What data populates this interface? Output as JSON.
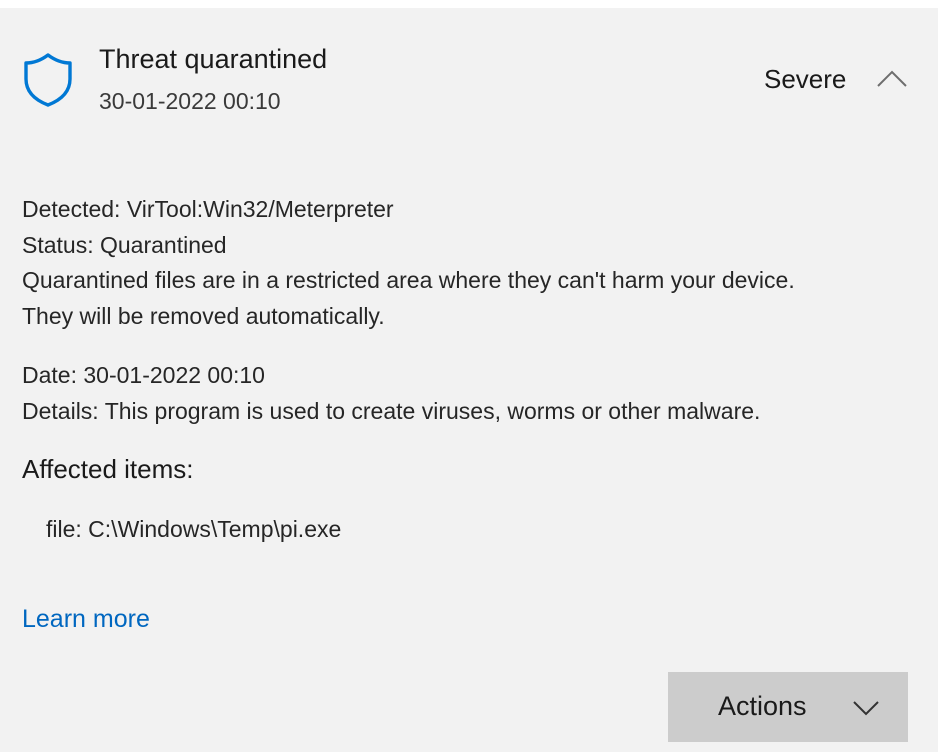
{
  "threat": {
    "title": "Threat quarantined",
    "timestamp": "30-01-2022 00:10",
    "severity": "Severe",
    "shield_icon": "shield-icon",
    "expand_icon": "chevron-up-icon",
    "accent_color": "#0078d4"
  },
  "details": {
    "detected_label": "Detected:",
    "detected_value": "VirTool:Win32/Meterpreter",
    "status_label": "Status:",
    "status_value": "Quarantined",
    "status_description_line1": "Quarantined files are in a restricted area where they can't harm your device.",
    "status_description_line2": "They will be removed automatically.",
    "date_label": "Date:",
    "date_value": "30-01-2022 00:10",
    "details_label": "Details:",
    "details_value": "This program is used to create viruses, worms or other malware."
  },
  "affected": {
    "title": "Affected items:",
    "items": [
      {
        "text": "file: C:\\Windows\\Temp\\pi.exe"
      }
    ]
  },
  "links": {
    "learn_more": "Learn more",
    "link_color": "#0067c0"
  },
  "actions": {
    "label": "Actions",
    "dropdown_icon": "chevron-down-icon"
  }
}
